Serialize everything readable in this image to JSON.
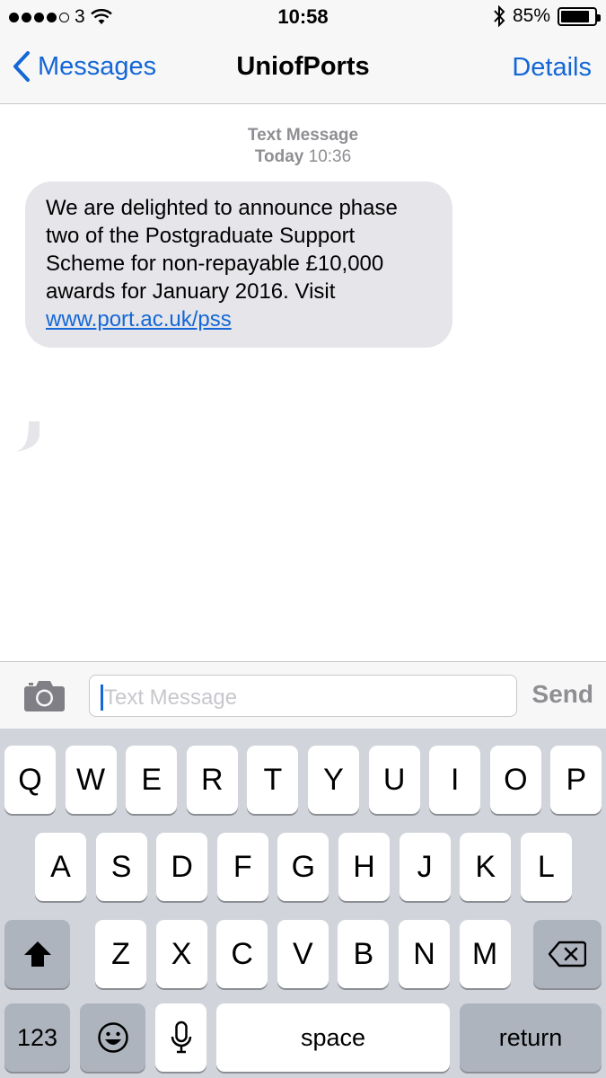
{
  "status_bar": {
    "carrier": "3",
    "time": "10:58",
    "battery": "85%",
    "battery_level": 0.85
  },
  "nav": {
    "back_label": "Messages",
    "title": "UniofPorts",
    "details_label": "Details"
  },
  "conversation": {
    "meta_label": "Text Message",
    "meta_day": "Today",
    "meta_time": "10:36",
    "message_text": "We are delighted to announce phase two of the Postgraduate Support Scheme for non-repayable £10,000 awards for January 2016. Visit",
    "message_link": "www.port.ac.uk/pss"
  },
  "input": {
    "placeholder": "Text Message",
    "send_label": "Send"
  },
  "keyboard": {
    "row1": [
      "Q",
      "W",
      "E",
      "R",
      "T",
      "Y",
      "U",
      "I",
      "O",
      "P"
    ],
    "row2": [
      "A",
      "S",
      "D",
      "F",
      "G",
      "H",
      "J",
      "K",
      "L"
    ],
    "row3": [
      "Z",
      "X",
      "C",
      "V",
      "B",
      "N",
      "M"
    ],
    "numbers_label": "123",
    "space_label": "space",
    "return_label": "return"
  },
  "icons": {
    "back": "chevron-left-icon",
    "wifi": "wifi-icon",
    "bluetooth": "bluetooth-icon",
    "battery": "battery-icon",
    "camera": "camera-icon",
    "shift": "shift-icon",
    "delete": "backspace-icon",
    "emoji": "emoji-icon",
    "microphone": "microphone-icon"
  },
  "colors": {
    "accent": "#1467d6",
    "bubble": "#e5e5ea",
    "keyboard_bg": "#d1d5db"
  }
}
